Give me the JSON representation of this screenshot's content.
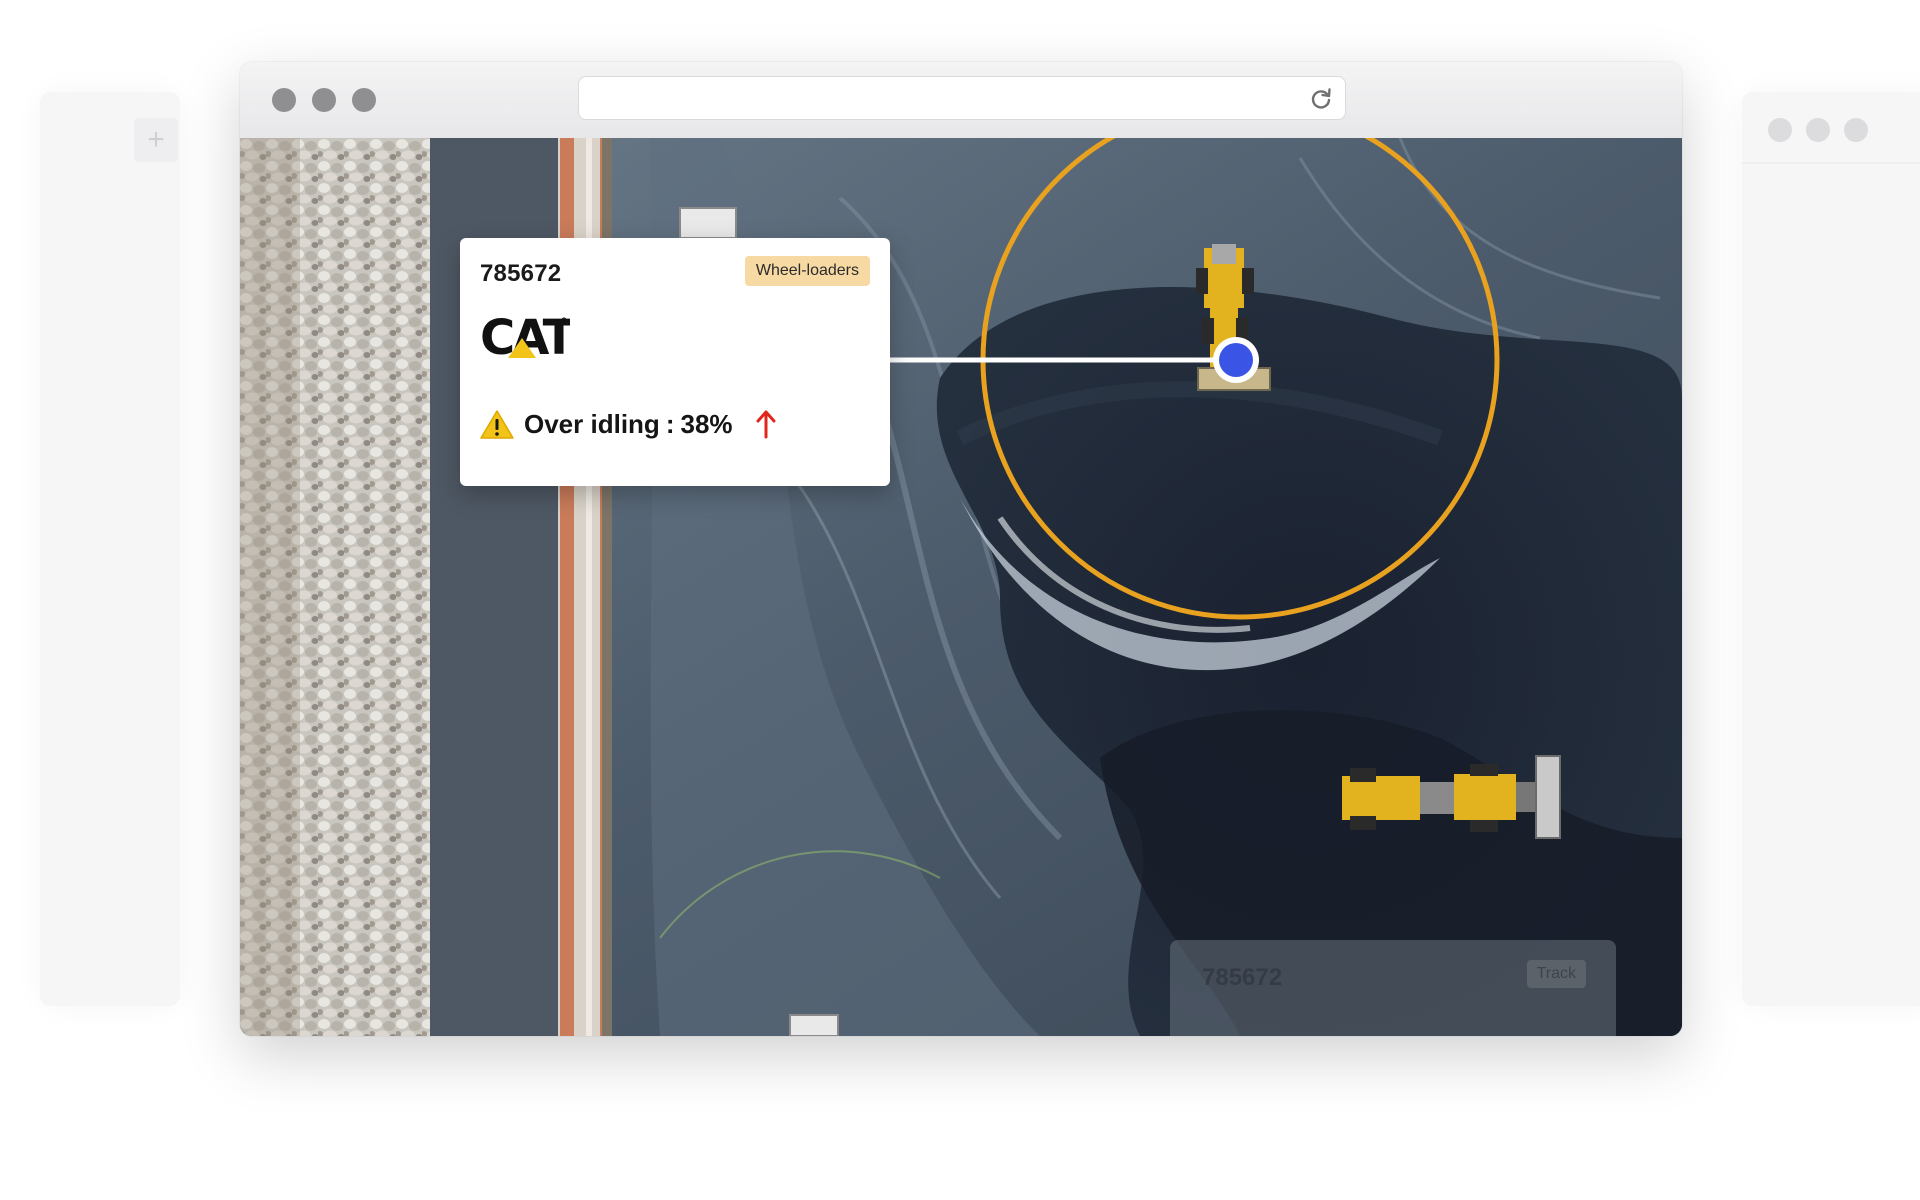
{
  "browser": {
    "url": ""
  },
  "card": {
    "machine_id": "785672",
    "category_badge": "Wheel-loaders",
    "brand_logo": "CAT",
    "alert": {
      "icon": "warning-icon",
      "label": "Over idling",
      "separator": ":",
      "value": "38%",
      "trend_icon": "arrow-up-icon",
      "trend_color": "#e0261d"
    }
  },
  "ghost_card": {
    "machine_id": "785672",
    "category_badge": "Track"
  },
  "map": {
    "geofence_color": "#e8a21f",
    "marker_color": "#3a55e6",
    "connector_color": "#ffffff"
  },
  "colors": {
    "badge_bg": "#f7d9a4",
    "traffic_light": "#8f8f92"
  }
}
